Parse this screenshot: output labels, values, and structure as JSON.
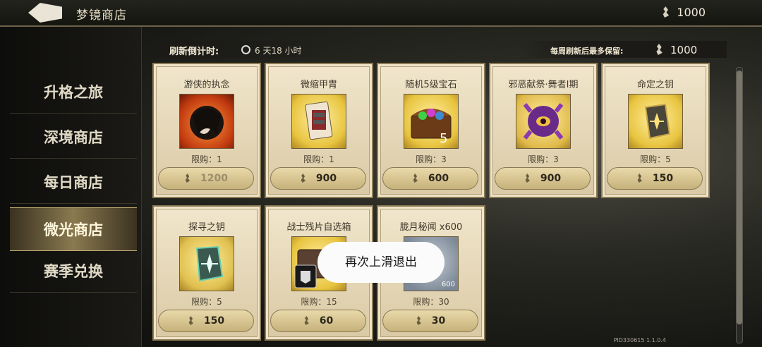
{
  "header": {
    "title": "梦镜商店",
    "currency_amount": "1000"
  },
  "sidebar": {
    "items": [
      {
        "label": "升格之旅"
      },
      {
        "label": "深境商店"
      },
      {
        "label": "每日商店"
      },
      {
        "label": "微光商店",
        "active": true
      },
      {
        "label": "赛季兑换"
      }
    ]
  },
  "info": {
    "refresh_label": "刷新倒计时:",
    "refresh_value": "6 天18 小时",
    "weekly_label": "每周刷新后最多保留:",
    "weekly_value": "1000"
  },
  "items": [
    {
      "name": "游侠的执念",
      "limit": "限购：1",
      "price": "1200",
      "disabled": true
    },
    {
      "name": "微缩甲胄",
      "limit": "限购：1",
      "price": "900"
    },
    {
      "name": "随机5级宝石",
      "limit": "限购：3",
      "price": "600"
    },
    {
      "name": "邪恶献祭·舞者I期",
      "limit": "限购：3",
      "price": "900"
    },
    {
      "name": "命定之钥",
      "limit": "限购：5",
      "price": "150"
    },
    {
      "name": "探寻之钥",
      "limit": "限购：5",
      "price": "150"
    },
    {
      "name": "战士残片自选箱",
      "limit": "限购：15",
      "price": "60"
    },
    {
      "name": "胧月秘闻 x600",
      "limit": "限购：30",
      "price": "30",
      "thumb_badge": "600"
    }
  ],
  "toast": "再次上滑退出",
  "version": "PID330615  1.1.0.4"
}
